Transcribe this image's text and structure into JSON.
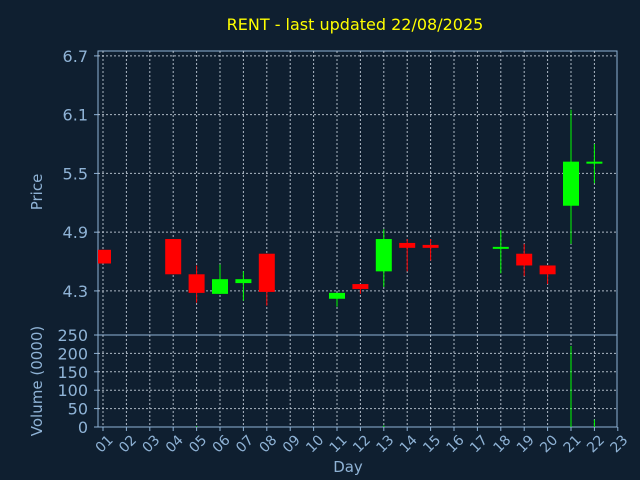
{
  "chart_data": [
    {
      "type": "candlestick",
      "title": "RENT - last updated 22/08/2025",
      "xlabel": "Day",
      "ylabel": "Price",
      "x_ticks": [
        "01",
        "02",
        "03",
        "04",
        "05",
        "06",
        "07",
        "08",
        "09",
        "10",
        "11",
        "12",
        "13",
        "14",
        "15",
        "16",
        "17",
        "18",
        "19",
        "20",
        "21",
        "22",
        "23"
      ],
      "y_ticks": [
        "4.3",
        "4.9",
        "5.5",
        "6.1",
        "6.7"
      ],
      "ylim": [
        3.85,
        6.75
      ],
      "xlim": [
        1,
        23
      ],
      "grid": true,
      "colors": {
        "up": "#00ff00",
        "down": "#ff0000"
      },
      "candles": [
        {
          "day": 1,
          "open": 4.72,
          "close": 4.58,
          "high": 4.72,
          "low": 4.58
        },
        {
          "day": 4,
          "open": 4.83,
          "close": 4.47,
          "high": 4.83,
          "low": 4.47
        },
        {
          "day": 5,
          "open": 4.47,
          "close": 4.28,
          "high": 4.56,
          "low": 4.18
        },
        {
          "day": 6,
          "open": 4.27,
          "close": 4.42,
          "high": 4.57,
          "low": 4.27
        },
        {
          "day": 7,
          "open": 4.38,
          "close": 4.42,
          "high": 4.5,
          "low": 4.2
        },
        {
          "day": 8,
          "open": 4.68,
          "close": 4.29,
          "high": 4.68,
          "low": 4.15
        },
        {
          "day": 11,
          "open": 4.22,
          "close": 4.28,
          "high": 4.28,
          "low": 4.14
        },
        {
          "day": 12,
          "open": 4.37,
          "close": 4.32,
          "high": 4.37,
          "low": 4.27
        },
        {
          "day": 13,
          "open": 4.5,
          "close": 4.83,
          "high": 4.93,
          "low": 4.34
        },
        {
          "day": 14,
          "open": 4.79,
          "close": 4.74,
          "high": 4.83,
          "low": 4.5
        },
        {
          "day": 15,
          "open": 4.77,
          "close": 4.74,
          "high": 4.83,
          "low": 4.61
        },
        {
          "day": 18,
          "open": 4.74,
          "close": 4.75,
          "high": 4.92,
          "low": 4.48
        },
        {
          "day": 19,
          "open": 4.68,
          "close": 4.56,
          "high": 4.78,
          "low": 4.45
        },
        {
          "day": 20,
          "open": 4.56,
          "close": 4.47,
          "high": 4.56,
          "low": 4.37
        },
        {
          "day": 21,
          "open": 5.17,
          "close": 5.62,
          "high": 6.15,
          "low": 4.78
        },
        {
          "day": 22,
          "open": 5.6,
          "close": 5.62,
          "high": 5.8,
          "low": 5.4
        }
      ]
    },
    {
      "type": "bar",
      "ylabel": "Volume (0000)",
      "y_ticks": [
        "0",
        "50",
        "100",
        "150",
        "200",
        "250"
      ],
      "ylim": [
        0,
        250
      ],
      "grid": true,
      "bars": [
        {
          "day": 5,
          "value": 2
        },
        {
          "day": 13,
          "value": 4
        },
        {
          "day": 21,
          "value": 220
        },
        {
          "day": 22,
          "value": 20
        }
      ]
    }
  ]
}
